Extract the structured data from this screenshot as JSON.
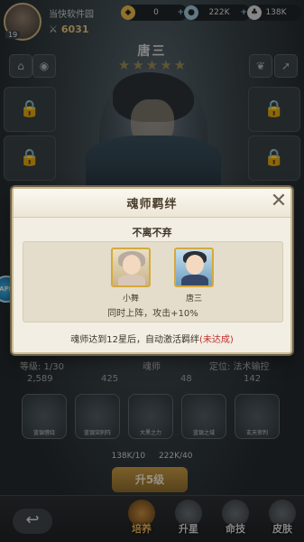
{
  "top_bar": {
    "player_name": "当快软件园",
    "level": "19",
    "power": "6031",
    "resources": [
      {
        "icon": "coin-icon",
        "value": "0"
      },
      {
        "icon": "gold-icon",
        "value": "222K"
      },
      {
        "icon": "exp-icon",
        "value": "138K"
      }
    ]
  },
  "hero": {
    "name": "唐三",
    "stars": 5
  },
  "background_info": {
    "level": "等级: 1/30",
    "class": "魂师",
    "role": "定位: 法术输控",
    "stats": [
      "2,589",
      "425",
      "48",
      "142"
    ],
    "skills": [
      "蓝银缠绕",
      "蓝银突刺阵",
      "大黑之力",
      "蓝银之域",
      "玄天审判"
    ],
    "cost": [
      "138K/10",
      "222K/40"
    ],
    "upgrade_label": "升5级"
  },
  "bottom_nav": {
    "back_icon": "back-arrow-icon",
    "tabs": [
      "培养",
      "升星",
      "命技",
      "皮肤"
    ],
    "active_tab": 0
  },
  "modal": {
    "title": "魂师羁绊",
    "bond_name": "不离不弃",
    "characters": [
      {
        "name": "小舞",
        "portrait": "xiaowu-portrait"
      },
      {
        "name": "唐三",
        "portrait": "tangsan-portrait"
      }
    ],
    "effect": "同时上阵，攻击+10%",
    "condition": "魂师达到12星后，自动激活羁绊",
    "status": "(未达成)"
  },
  "colors": {
    "accent_gold": "#d7a93b",
    "status_red": "#c0302a",
    "modal_bg": "#f2eee3"
  }
}
